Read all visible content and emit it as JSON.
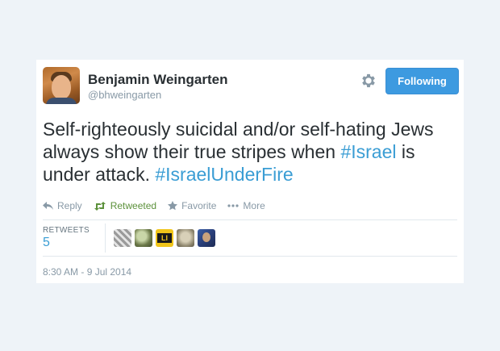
{
  "tweet": {
    "author": {
      "name": "Benjamin Weingarten",
      "handle": "@bhweingarten"
    },
    "follow_button_label": "Following",
    "text": {
      "part1": "Self-righteously suicidal and/or self-hating Jews always show their true stripes when ",
      "hashtag1": "#Israel",
      "part2": " is under attack. ",
      "hashtag2": "#IsraelUnderFire"
    },
    "actions": {
      "reply": "Reply",
      "retweeted": "Retweeted",
      "favorite": "Favorite",
      "more": "More"
    },
    "stats": {
      "retweets_label": "RETWEETS",
      "retweets_count": "5"
    },
    "retweeter_badge_text": "LI",
    "timestamp": "8:30 AM - 9 Jul 2014"
  },
  "colors": {
    "page_background": "#eef3f8",
    "accent_blue": "#3d9ae0",
    "hashtag_blue": "#3a9dd4",
    "retweeted_green": "#5c913b",
    "muted_gray": "#8899a6"
  },
  "icons": [
    "settings-gear-icon",
    "reply-arrow-icon",
    "retweet-icon",
    "star-icon",
    "more-dots-icon"
  ]
}
